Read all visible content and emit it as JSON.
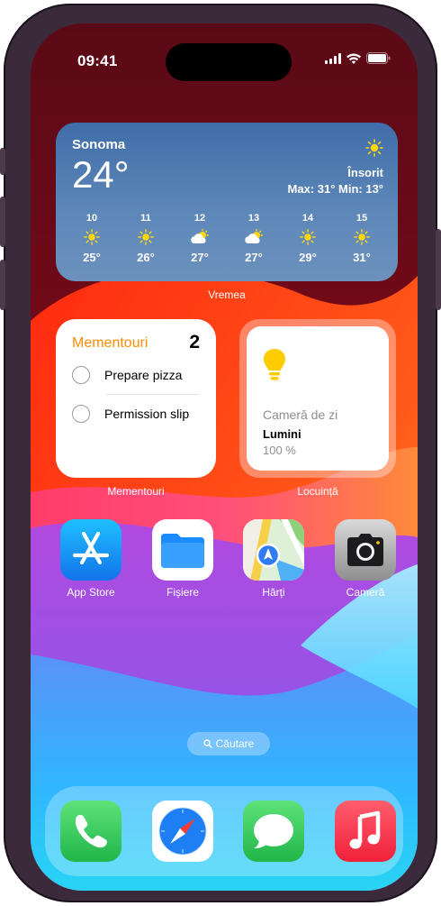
{
  "status_bar": {
    "time": "09:41"
  },
  "weather_widget": {
    "city": "Sonoma",
    "temperature": "24°",
    "condition": "Însorit",
    "range": "Max: 31° Min: 13°",
    "icon": "sun-icon",
    "forecast": [
      {
        "hour": "10",
        "icon": "sun-icon",
        "temp": "25°"
      },
      {
        "hour": "11",
        "icon": "sun-icon",
        "temp": "26°"
      },
      {
        "hour": "12",
        "icon": "partly-cloudy-icon",
        "temp": "27°"
      },
      {
        "hour": "13",
        "icon": "partly-cloudy-icon",
        "temp": "27°"
      },
      {
        "hour": "14",
        "icon": "sun-icon",
        "temp": "29°"
      },
      {
        "hour": "15",
        "icon": "sun-icon",
        "temp": "31°"
      }
    ],
    "label": "Vremea"
  },
  "reminders_widget": {
    "title": "Mementouri",
    "count": "2",
    "items": [
      "Prepare pizza",
      "Permission slip"
    ],
    "label": "Mementouri"
  },
  "home_widget": {
    "room": "Cameră de zi",
    "accessory": "Lumini",
    "value": "100 %",
    "label": "Locuință",
    "icon": "lightbulb-icon"
  },
  "apps": [
    {
      "label": "App Store",
      "icon": "app-store-icon"
    },
    {
      "label": "Fișiere",
      "icon": "files-icon"
    },
    {
      "label": "Hărți",
      "icon": "maps-icon"
    },
    {
      "label": "Cameră",
      "icon": "camera-icon"
    }
  ],
  "search": {
    "label": "Căutare",
    "icon": "search-icon"
  },
  "dock": [
    {
      "icon": "phone-icon"
    },
    {
      "icon": "safari-icon"
    },
    {
      "icon": "messages-icon"
    },
    {
      "icon": "music-icon"
    }
  ],
  "colors": {
    "reminders_accent": "#ff8c00",
    "phone_green": "#34c759",
    "music_red": "#fc3c44",
    "weather_blue": "#4a76ad"
  }
}
